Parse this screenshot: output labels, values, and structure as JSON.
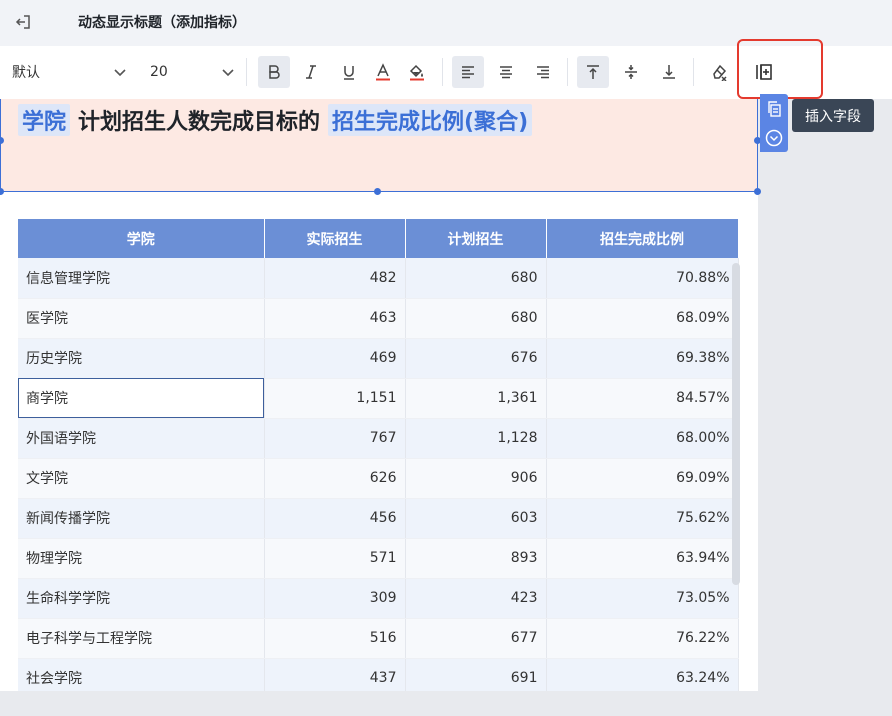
{
  "header": {
    "title": "动态显示标题（添加指标）"
  },
  "toolbar": {
    "font_family": "默认",
    "font_size": "20",
    "icons": [
      "bold-icon",
      "italic-icon",
      "underline-icon",
      "font-color-icon",
      "fill-color-icon",
      "align-left-icon",
      "align-center-icon",
      "align-right-icon",
      "valign-top-icon",
      "valign-middle-icon",
      "valign-bottom-icon",
      "clear-format-icon",
      "insert-field-icon"
    ]
  },
  "title": {
    "field1": "学院",
    "text": "计划招生人数完成目标的",
    "field2": "招生完成比例(聚合)"
  },
  "tooltip": "插入字段",
  "table": {
    "headers": [
      "学院",
      "实际招生",
      "计划招生",
      "招生完成比例"
    ],
    "rows": [
      [
        "信息管理学院",
        "482",
        "680",
        "70.88%"
      ],
      [
        "医学院",
        "463",
        "680",
        "68.09%"
      ],
      [
        "历史学院",
        "469",
        "676",
        "69.38%"
      ],
      [
        "商学院",
        "1,151",
        "1,361",
        "84.57%"
      ],
      [
        "外国语学院",
        "767",
        "1,128",
        "68.00%"
      ],
      [
        "文学院",
        "626",
        "906",
        "69.09%"
      ],
      [
        "新闻传播学院",
        "456",
        "603",
        "75.62%"
      ],
      [
        "物理学院",
        "571",
        "893",
        "63.94%"
      ],
      [
        "生命科学学院",
        "309",
        "423",
        "73.05%"
      ],
      [
        "电子科学与工程学院",
        "516",
        "677",
        "76.22%"
      ],
      [
        "社会学院",
        "437",
        "691",
        "63.24%"
      ]
    ]
  },
  "colors": {
    "accent": "#3d6fd6",
    "header_bg": "#6b8fd6",
    "title_bg": "#fde9e3",
    "highlight": "#e43a2e"
  }
}
